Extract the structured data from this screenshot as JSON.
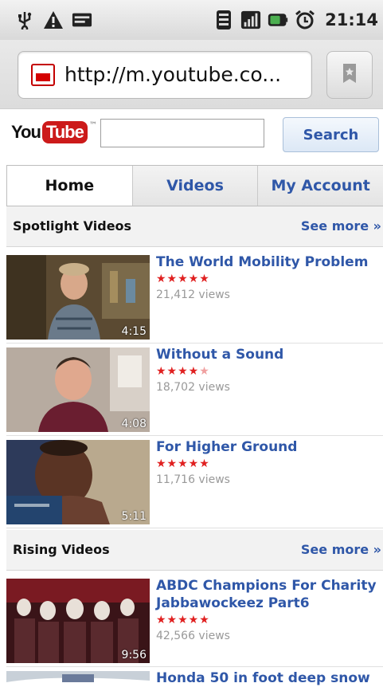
{
  "status_bar": {
    "time": "21:14",
    "icons": [
      "usb-icon",
      "warning-icon",
      "keyboard-icon",
      "wifi-icon",
      "signal-icon",
      "battery-icon",
      "alarm-icon"
    ]
  },
  "browser": {
    "url": "http://m.youtube.co...",
    "favicon": "youtube-favicon-icon",
    "bookmark_icon": "bookmark-icon"
  },
  "header": {
    "logo_you": "You",
    "logo_tube": "Tube",
    "search_placeholder": "",
    "search_value": "",
    "search_button": "Search"
  },
  "tabs": [
    {
      "label": "Home",
      "active": true
    },
    {
      "label": "Videos",
      "active": false
    },
    {
      "label": "My Account",
      "active": false
    }
  ],
  "sections": {
    "spotlight": {
      "title": "Spotlight Videos",
      "see_more": "See more »",
      "videos": [
        {
          "title": "The World Mobility Problem",
          "rating": 5,
          "views": "21,412 views",
          "duration": "4:15"
        },
        {
          "title": "Without a Sound",
          "rating": 4.5,
          "views": "18,702 views",
          "duration": "4:08"
        },
        {
          "title": "For Higher Ground",
          "rating": 5,
          "views": "11,716 views",
          "duration": "5:11"
        }
      ]
    },
    "rising": {
      "title": "Rising Videos",
      "see_more": "See more »",
      "videos": [
        {
          "title": "ABDC Champions For Charity Jabbawockeez Part6",
          "rating": 5,
          "views": "42,566 views",
          "duration": "9:56"
        },
        {
          "title": "Honda 50 in foot deep snow",
          "rating": null,
          "views": "",
          "duration": ""
        }
      ]
    }
  },
  "colors": {
    "link_blue": "#2f57a8",
    "star_red": "#e02020",
    "youtube_red": "#cc1a1a"
  }
}
